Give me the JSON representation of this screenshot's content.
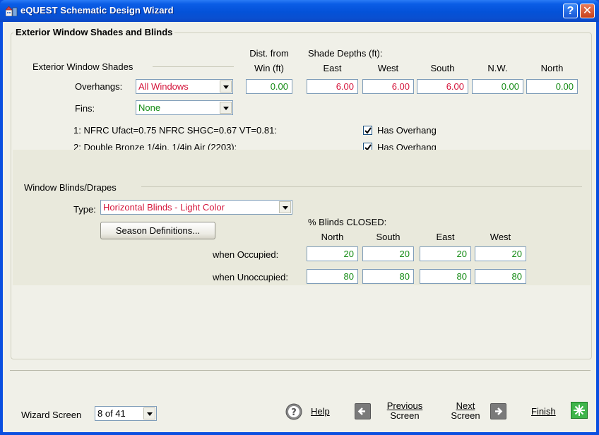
{
  "window": {
    "title": "eQUEST Schematic Design Wizard",
    "help_glyph": "?",
    "close_glyph": "✕"
  },
  "shades": {
    "group_title": "Exterior Window Shades and Blinds",
    "subgroup_title": "Exterior Window Shades",
    "dist_header_1": "Dist. from",
    "dist_header_2": "Win (ft)",
    "depths_header": "Shade Depths (ft):",
    "columns": [
      "East",
      "West",
      "South",
      "N.W.",
      "North"
    ],
    "overhangs_label": "Overhangs:",
    "overhangs_value": "All Windows",
    "fins_label": "Fins:",
    "fins_value": "None",
    "dist_value": "0.00",
    "depth_values": [
      "6.00",
      "6.00",
      "6.00",
      "0.00",
      "0.00"
    ],
    "glass_1": "1: NFRC Ufact=0.75  NFRC SHGC=0.67  VT=0.81:",
    "glass_2": "2: Double Bronze 1/4in, 1/4in Air (2203):",
    "has_overhang_label": "Has Overhang",
    "has_overhang_1": true,
    "has_overhang_2": true
  },
  "blinds": {
    "group_title": "Window Blinds/Drapes",
    "type_label": "Type:",
    "type_value": "Horizontal Blinds - Light Color",
    "season_button": "Season Definitions...",
    "closed_header": "% Blinds CLOSED:",
    "columns": [
      "North",
      "South",
      "East",
      "West"
    ],
    "occupied_label": "when Occupied:",
    "unoccupied_label": "when Unoccupied:",
    "occupied_values": [
      "20",
      "20",
      "20",
      "20"
    ],
    "unoccupied_values": [
      "80",
      "80",
      "80",
      "80"
    ]
  },
  "footer": {
    "wizard_screen_label": "Wizard Screen",
    "wizard_screen_value": "8 of 41",
    "help_label": "Help",
    "previous_line1": "Previous",
    "previous_line2": "Screen",
    "next_line1": "Next",
    "next_line2": "Screen",
    "finish_label": "Finish"
  },
  "colors": {
    "title_blue": "#0a4fe0",
    "dialog_bg": "#f0f0e8",
    "value_green": "#138a13",
    "value_red": "#d4143a"
  }
}
